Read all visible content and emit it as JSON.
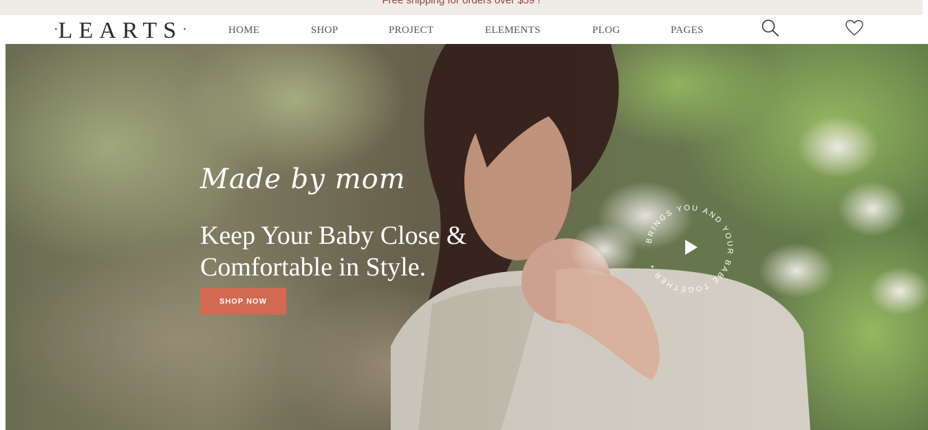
{
  "announcement": {
    "text": "Free shipping for orders over $59 !"
  },
  "brand": {
    "logo_text": "LEARTS",
    "logo_dot": "·"
  },
  "nav": {
    "items": [
      {
        "label": "HOME"
      },
      {
        "label": "SHOP"
      },
      {
        "label": "PROJECT"
      },
      {
        "label": "ELEMENTS"
      },
      {
        "label": "PLOG"
      },
      {
        "label": "PAGES"
      }
    ],
    "icons": [
      "search-icon",
      "heart-icon"
    ]
  },
  "hero": {
    "tagline": "Made by mom",
    "headline_line1": "Keep Your Baby Close &",
    "headline_line2": "Comfortable in Style.",
    "cta_label": "SHOP NOW",
    "badge_text": "BRINGS YOU AND YOUR BABE TOGETHER • "
  },
  "colors": {
    "accent": "#d26a53",
    "announcement_bg": "#efebe7",
    "announcement_text": "#8c4538"
  }
}
